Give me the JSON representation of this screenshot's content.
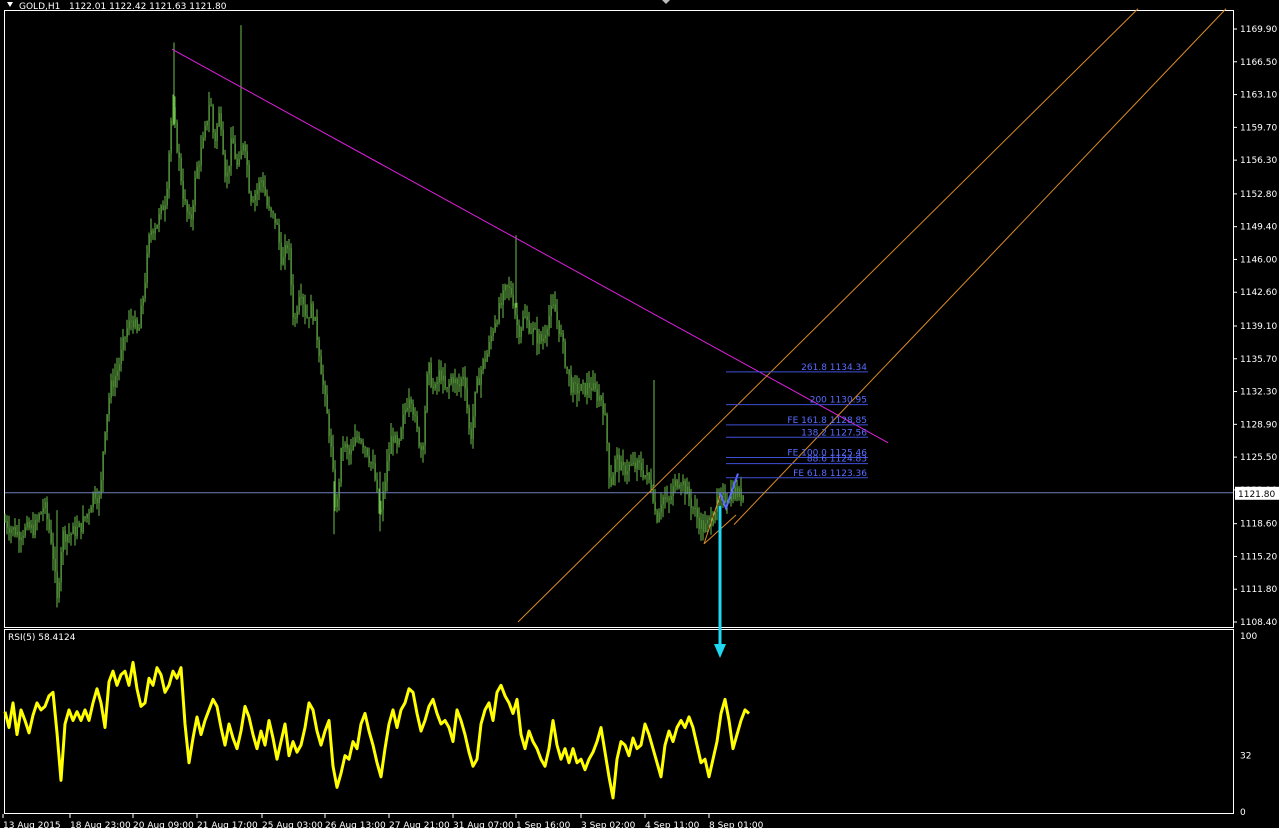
{
  "header": {
    "symbol_label": "GOLD,H1",
    "ohlc": "1122.01 1122.42 1121.63 1121.80"
  },
  "price_axis": {
    "ticks": [
      "1169.90",
      "1166.50",
      "1163.10",
      "1159.70",
      "1156.30",
      "1152.80",
      "1149.40",
      "1146.00",
      "1142.60",
      "1139.10",
      "1135.70",
      "1132.30",
      "1128.90",
      "1125.50",
      "1122.10",
      "1118.60",
      "1115.20",
      "1111.80",
      "1108.40"
    ],
    "current_price_label": "1121.80"
  },
  "time_axis": {
    "labels": [
      "13 Aug 2015",
      "18 Aug 23:00",
      "20 Aug 09:00",
      "21 Aug 17:00",
      "25 Aug 03:00",
      "26 Aug 13:00",
      "27 Aug 21:00",
      "31 Aug 07:00",
      "1 Sep 16:00",
      "3 Sep 02:00",
      "4 Sep 11:00",
      "8 Sep 01:00"
    ]
  },
  "fib_levels": [
    {
      "label": "261.8  1134.34",
      "price": 1134.34
    },
    {
      "label": "200  1130.95",
      "price": 1130.95
    },
    {
      "label": "FE 161.8  1128.85",
      "price": 1128.85
    },
    {
      "label": "138.2  1127.56",
      "price": 1127.56
    },
    {
      "label": "FE 100.0  1125.46",
      "price": 1125.46
    },
    {
      "label": "88.6  1124.83",
      "price": 1124.83
    },
    {
      "label": "FE 61.8  1123.36",
      "price": 1123.36
    }
  ],
  "rsi": {
    "label": "RSI(5) 58.4124",
    "ticks": [
      "100",
      "32",
      "0"
    ]
  },
  "colors": {
    "candle": "#6cc04a",
    "trendline": "#e020e0",
    "channel": "#d98b28",
    "fib": "#3f4fd6",
    "fib_text": "#5a6cff",
    "rsi_line": "#ffff00",
    "arrow": "#20d8f0",
    "axis_text": "#ffffff"
  },
  "chart_data": {
    "type": "candlestick",
    "instrument": "GOLD",
    "timeframe": "H1",
    "ylim": [
      1108.4,
      1170.5
    ],
    "close_points": [
      [
        0,
        1120.5
      ],
      [
        4,
        1119
      ],
      [
        10,
        1118.2
      ],
      [
        18,
        1117.6
      ],
      [
        26,
        1118.0
      ],
      [
        34,
        1118.1
      ],
      [
        44,
        1120.6
      ],
      [
        52,
        1116.5
      ],
      [
        57,
        1110.5
      ],
      [
        62,
        1117.5
      ],
      [
        70,
        1117.5
      ],
      [
        80,
        1118.2
      ],
      [
        88,
        1119.8
      ],
      [
        94,
        1122.0
      ],
      [
        100,
        1121.0
      ],
      [
        104,
        1128.0
      ],
      [
        110,
        1132.5
      ],
      [
        118,
        1134.8
      ],
      [
        126,
        1138.5
      ],
      [
        132,
        1140.0
      ],
      [
        138,
        1138.0
      ],
      [
        144,
        1143.0
      ],
      [
        150,
        1149.0
      ],
      [
        158,
        1150.0
      ],
      [
        166,
        1152.5
      ],
      [
        172,
        1162.0
      ],
      [
        178,
        1157.0
      ],
      [
        184,
        1152.0
      ],
      [
        190,
        1149.5
      ],
      [
        196,
        1155.0
      ],
      [
        204,
        1158.5
      ],
      [
        210,
        1163.0
      ],
      [
        214,
        1158.0
      ],
      [
        220,
        1161.5
      ],
      [
        226,
        1154.0
      ],
      [
        232,
        1158.5
      ],
      [
        238,
        1155.0
      ],
      [
        244,
        1159.0
      ],
      [
        250,
        1152.5
      ],
      [
        256,
        1153.0
      ],
      [
        262,
        1154.5
      ],
      [
        268,
        1151.0
      ],
      [
        276,
        1150.0
      ],
      [
        282,
        1145.5
      ],
      [
        288,
        1148.0
      ],
      [
        294,
        1139.0
      ],
      [
        300,
        1143.5
      ],
      [
        306,
        1140.0
      ],
      [
        312,
        1141.0
      ],
      [
        318,
        1137.5
      ],
      [
        324,
        1132.0
      ],
      [
        330,
        1127.5
      ],
      [
        336,
        1119.5
      ],
      [
        342,
        1127.0
      ],
      [
        350,
        1125.5
      ],
      [
        358,
        1128.0
      ],
      [
        366,
        1126.5
      ],
      [
        374,
        1124.0
      ],
      [
        380,
        1119.0
      ],
      [
        386,
        1124.0
      ],
      [
        392,
        1128.0
      ],
      [
        398,
        1126.0
      ],
      [
        404,
        1130.0
      ],
      [
        410,
        1132.5
      ],
      [
        416,
        1128.5
      ],
      [
        422,
        1126.0
      ],
      [
        428,
        1135.0
      ],
      [
        434,
        1132.0
      ],
      [
        440,
        1134.5
      ],
      [
        446,
        1132.0
      ],
      [
        452,
        1134.0
      ],
      [
        458,
        1132.5
      ],
      [
        464,
        1134.5
      ],
      [
        470,
        1127.0
      ],
      [
        476,
        1132.5
      ],
      [
        482,
        1135.0
      ],
      [
        488,
        1136.5
      ],
      [
        494,
        1139.5
      ],
      [
        500,
        1141.0
      ],
      [
        506,
        1143.0
      ],
      [
        512,
        1142.5
      ],
      [
        518,
        1138.5
      ],
      [
        524,
        1140.0
      ],
      [
        530,
        1139.0
      ],
      [
        536,
        1138.0
      ],
      [
        542,
        1137.5
      ],
      [
        548,
        1140.0
      ],
      [
        554,
        1141.0
      ],
      [
        560,
        1138.5
      ],
      [
        566,
        1135.0
      ],
      [
        572,
        1132.5
      ],
      [
        578,
        1132.5
      ],
      [
        584,
        1132.5
      ],
      [
        590,
        1133.0
      ],
      [
        596,
        1132.0
      ],
      [
        602,
        1131.5
      ],
      [
        606,
        1128.5
      ],
      [
        610,
        1122.5
      ],
      [
        616,
        1125.5
      ],
      [
        622,
        1124.0
      ],
      [
        628,
        1124.5
      ],
      [
        634,
        1124.5
      ],
      [
        640,
        1124.5
      ],
      [
        646,
        1123.5
      ],
      [
        652,
        1122.5
      ],
      [
        656,
        1119.0
      ],
      [
        662,
        1121.5
      ],
      [
        668,
        1120.5
      ],
      [
        674,
        1122.5
      ],
      [
        680,
        1123.5
      ],
      [
        686,
        1122.0
      ],
      [
        692,
        1120.5
      ],
      [
        698,
        1119.0
      ],
      [
        704,
        1118.0
      ],
      [
        710,
        1119.0
      ],
      [
        716,
        1120.5
      ],
      [
        722,
        1121.0
      ],
      [
        728,
        1121.5
      ],
      [
        734,
        1122.0
      ],
      [
        740,
        1121.5
      ],
      [
        744,
        1121.8
      ]
    ],
    "rsi_values": [
      [
        0,
        57
      ],
      [
        4,
        48
      ],
      [
        8,
        62
      ],
      [
        12,
        44
      ],
      [
        16,
        58
      ],
      [
        20,
        52
      ],
      [
        24,
        45
      ],
      [
        28,
        55
      ],
      [
        32,
        62
      ],
      [
        36,
        58
      ],
      [
        40,
        60
      ],
      [
        44,
        66
      ],
      [
        48,
        68
      ],
      [
        52,
        45
      ],
      [
        56,
        18
      ],
      [
        60,
        50
      ],
      [
        64,
        58
      ],
      [
        68,
        52
      ],
      [
        72,
        57
      ],
      [
        76,
        52
      ],
      [
        80,
        58
      ],
      [
        84,
        52
      ],
      [
        88,
        62
      ],
      [
        92,
        70
      ],
      [
        96,
        62
      ],
      [
        100,
        48
      ],
      [
        104,
        74
      ],
      [
        108,
        80
      ],
      [
        112,
        72
      ],
      [
        116,
        78
      ],
      [
        120,
        80
      ],
      [
        124,
        72
      ],
      [
        128,
        85
      ],
      [
        132,
        70
      ],
      [
        136,
        60
      ],
      [
        140,
        62
      ],
      [
        144,
        76
      ],
      [
        148,
        72
      ],
      [
        152,
        82
      ],
      [
        156,
        78
      ],
      [
        160,
        68
      ],
      [
        164,
        72
      ],
      [
        168,
        80
      ],
      [
        172,
        76
      ],
      [
        176,
        82
      ],
      [
        180,
        50
      ],
      [
        184,
        28
      ],
      [
        188,
        42
      ],
      [
        192,
        54
      ],
      [
        196,
        44
      ],
      [
        200,
        52
      ],
      [
        204,
        58
      ],
      [
        208,
        64
      ],
      [
        212,
        60
      ],
      [
        216,
        48
      ],
      [
        220,
        38
      ],
      [
        224,
        50
      ],
      [
        228,
        42
      ],
      [
        232,
        36
      ],
      [
        236,
        46
      ],
      [
        240,
        60
      ],
      [
        244,
        54
      ],
      [
        248,
        44
      ],
      [
        252,
        36
      ],
      [
        256,
        46
      ],
      [
        260,
        38
      ],
      [
        264,
        52
      ],
      [
        268,
        42
      ],
      [
        272,
        30
      ],
      [
        276,
        40
      ],
      [
        280,
        50
      ],
      [
        284,
        32
      ],
      [
        288,
        40
      ],
      [
        292,
        34
      ],
      [
        296,
        38
      ],
      [
        300,
        48
      ],
      [
        304,
        62
      ],
      [
        308,
        58
      ],
      [
        312,
        46
      ],
      [
        316,
        38
      ],
      [
        320,
        46
      ],
      [
        324,
        52
      ],
      [
        328,
        26
      ],
      [
        332,
        14
      ],
      [
        336,
        22
      ],
      [
        340,
        32
      ],
      [
        344,
        30
      ],
      [
        348,
        40
      ],
      [
        352,
        36
      ],
      [
        356,
        50
      ],
      [
        360,
        56
      ],
      [
        364,
        46
      ],
      [
        368,
        38
      ],
      [
        372,
        28
      ],
      [
        376,
        20
      ],
      [
        380,
        36
      ],
      [
        384,
        50
      ],
      [
        388,
        58
      ],
      [
        392,
        48
      ],
      [
        396,
        58
      ],
      [
        400,
        62
      ],
      [
        404,
        70
      ],
      [
        408,
        68
      ],
      [
        412,
        56
      ],
      [
        416,
        46
      ],
      [
        420,
        52
      ],
      [
        424,
        60
      ],
      [
        428,
        64
      ],
      [
        432,
        56
      ],
      [
        436,
        50
      ],
      [
        440,
        52
      ],
      [
        444,
        48
      ],
      [
        448,
        40
      ],
      [
        452,
        58
      ],
      [
        456,
        52
      ],
      [
        460,
        44
      ],
      [
        464,
        34
      ],
      [
        468,
        26
      ],
      [
        472,
        30
      ],
      [
        476,
        50
      ],
      [
        480,
        58
      ],
      [
        484,
        62
      ],
      [
        488,
        52
      ],
      [
        492,
        68
      ],
      [
        496,
        72
      ],
      [
        500,
        66
      ],
      [
        504,
        62
      ],
      [
        508,
        56
      ],
      [
        512,
        64
      ],
      [
        516,
        44
      ],
      [
        520,
        36
      ],
      [
        524,
        46
      ],
      [
        528,
        40
      ],
      [
        532,
        36
      ],
      [
        536,
        30
      ],
      [
        540,
        26
      ],
      [
        544,
        36
      ],
      [
        548,
        52
      ],
      [
        552,
        38
      ],
      [
        556,
        30
      ],
      [
        560,
        36
      ],
      [
        564,
        28
      ],
      [
        568,
        36
      ],
      [
        572,
        28
      ],
      [
        576,
        30
      ],
      [
        580,
        24
      ],
      [
        584,
        30
      ],
      [
        588,
        34
      ],
      [
        592,
        40
      ],
      [
        596,
        48
      ],
      [
        600,
        34
      ],
      [
        604,
        20
      ],
      [
        608,
        8
      ],
      [
        612,
        30
      ],
      [
        616,
        40
      ],
      [
        620,
        38
      ],
      [
        624,
        32
      ],
      [
        628,
        42
      ],
      [
        632,
        36
      ],
      [
        636,
        38
      ],
      [
        640,
        50
      ],
      [
        644,
        44
      ],
      [
        648,
        36
      ],
      [
        652,
        28
      ],
      [
        656,
        20
      ],
      [
        660,
        38
      ],
      [
        664,
        46
      ],
      [
        668,
        40
      ],
      [
        672,
        48
      ],
      [
        676,
        52
      ],
      [
        680,
        48
      ],
      [
        684,
        54
      ],
      [
        688,
        48
      ],
      [
        692,
        38
      ],
      [
        696,
        28
      ],
      [
        700,
        30
      ],
      [
        704,
        20
      ],
      [
        708,
        30
      ],
      [
        712,
        40
      ],
      [
        716,
        56
      ],
      [
        720,
        64
      ],
      [
        724,
        52
      ],
      [
        728,
        36
      ],
      [
        732,
        44
      ],
      [
        736,
        52
      ],
      [
        740,
        58
      ],
      [
        744,
        56
      ]
    ],
    "trendline": {
      "from": [
        172,
        1167.8
      ],
      "to": [
        888,
        1127.0
      ]
    },
    "channel_lines": [
      {
        "from": [
          518,
          1108.4
        ],
        "to": [
          1138,
          1172
        ]
      },
      {
        "from": [
          734,
          1118.5
        ],
        "to": [
          1226,
          1172
        ]
      }
    ],
    "horizontal_line": 1121.8,
    "grid": false
  }
}
